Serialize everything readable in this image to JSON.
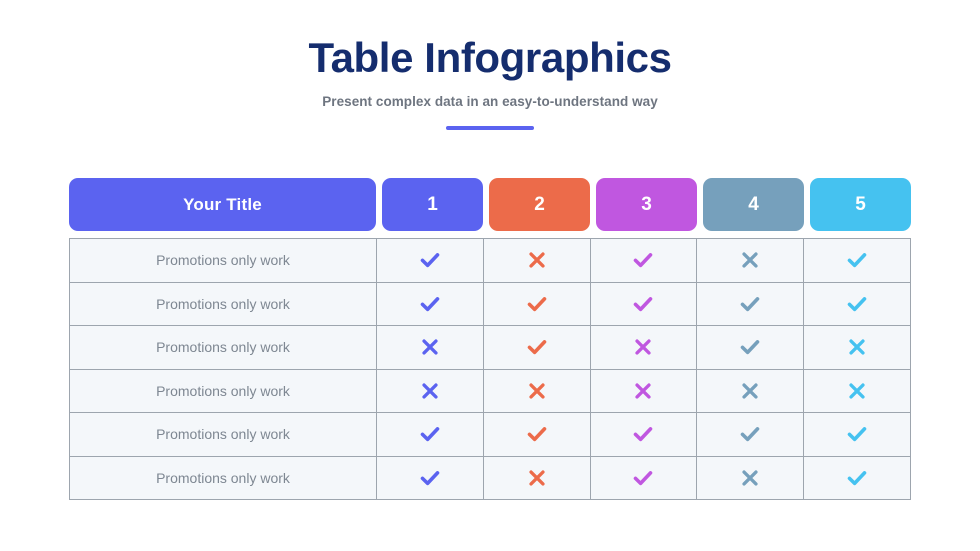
{
  "header": {
    "title": "Table Infographics",
    "subtitle": "Present complex data in an easy-to-understand way",
    "title_color": "#152D6E",
    "subtitle_color": "#6E7580",
    "accent_color": "#5B63F0"
  },
  "table": {
    "columns": [
      {
        "label": "Your Title",
        "color": "#5B63F0"
      },
      {
        "label": "1",
        "color": "#5B63F0"
      },
      {
        "label": "2",
        "color": "#EC6B4A"
      },
      {
        "label": "3",
        "color": "#C057E0"
      },
      {
        "label": "4",
        "color": "#76A0BC"
      },
      {
        "label": "5",
        "color": "#45C2F0"
      }
    ],
    "cell_background": "#F4F7FA",
    "border_color": "#9DA5AE",
    "label_color": "#7E8792",
    "rows": [
      {
        "label": "Promotions only work",
        "marks": [
          "check",
          "cross",
          "check",
          "cross",
          "check"
        ]
      },
      {
        "label": "Promotions only work",
        "marks": [
          "check",
          "check",
          "check",
          "check",
          "check"
        ]
      },
      {
        "label": "Promotions only work",
        "marks": [
          "cross",
          "check",
          "cross",
          "check",
          "cross"
        ]
      },
      {
        "label": "Promotions only work",
        "marks": [
          "cross",
          "cross",
          "cross",
          "cross",
          "cross"
        ]
      },
      {
        "label": "Promotions only work",
        "marks": [
          "check",
          "check",
          "check",
          "check",
          "check"
        ]
      },
      {
        "label": "Promotions only work",
        "marks": [
          "check",
          "cross",
          "check",
          "cross",
          "check"
        ]
      }
    ]
  }
}
